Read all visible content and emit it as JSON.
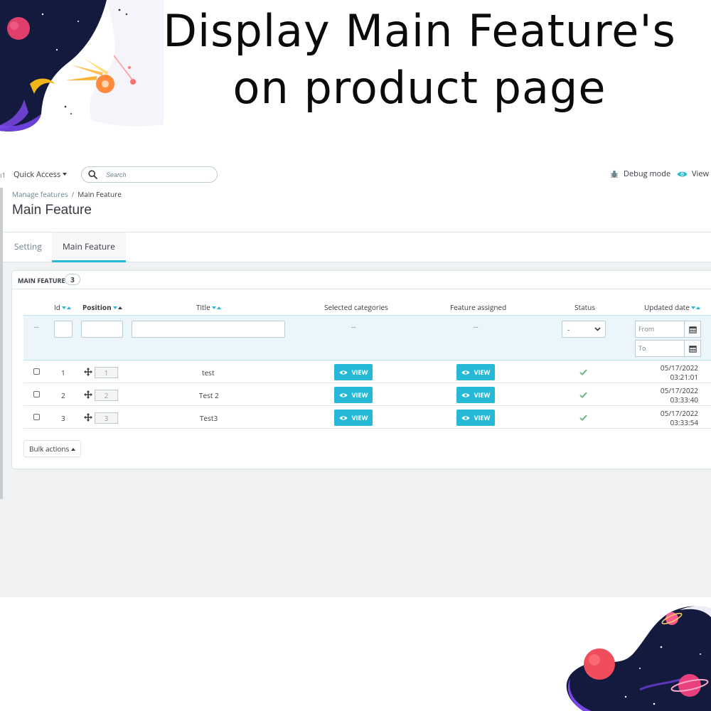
{
  "headline": {
    "line1": "Display Main Feature's",
    "line2": "on product page"
  },
  "topbar": {
    "left_fragment": "ı1",
    "quick_access": "Quick Access",
    "search_placeholder": "Search",
    "debug_mode": "Debug mode",
    "view_link": "View m"
  },
  "breadcrumb": {
    "parent": "Manage features",
    "separator": "/",
    "current": "Main Feature"
  },
  "page_title": "Main Feature",
  "tabs": [
    {
      "label": "Setting",
      "active": false
    },
    {
      "label": "Main Feature",
      "active": true
    }
  ],
  "panel": {
    "title": "MAIN FEATURE",
    "count": "3"
  },
  "columns": {
    "id": "Id",
    "position": "Position",
    "title": "Title",
    "selected_categories": "Selected categories",
    "feature_assigned": "Feature assigned",
    "status": "Status",
    "updated_date": "Updated date"
  },
  "filters": {
    "id_dash": "--",
    "categories_dash": "--",
    "feature_dash": "--",
    "status_value": "-",
    "date_from_placeholder": "From",
    "date_to_placeholder": "To"
  },
  "rows": [
    {
      "id": "1",
      "position": "1",
      "title": "test",
      "categories_btn": "VIEW",
      "feature_btn": "VIEW",
      "status": "enabled",
      "date": "05/17/2022",
      "time": "03:21:01"
    },
    {
      "id": "2",
      "position": "2",
      "title": "Test 2",
      "categories_btn": "VIEW",
      "feature_btn": "VIEW",
      "status": "enabled",
      "date": "05/17/2022",
      "time": "03:33:40"
    },
    {
      "id": "3",
      "position": "3",
      "title": "Test3",
      "categories_btn": "VIEW",
      "feature_btn": "VIEW",
      "status": "enabled",
      "date": "05/17/2022",
      "time": "03:33:54"
    }
  ],
  "bulk_actions": "Bulk actions",
  "colors": {
    "accent": "#25b9d7",
    "success": "#70b580",
    "text": "#363a41",
    "muted": "#6c868e",
    "page_bg": "#eff1f2"
  },
  "icons": [
    "search-icon",
    "bug-icon",
    "eye-icon",
    "drag-move-icon",
    "check-icon",
    "calendar-icon",
    "chevron-down-icon"
  ]
}
